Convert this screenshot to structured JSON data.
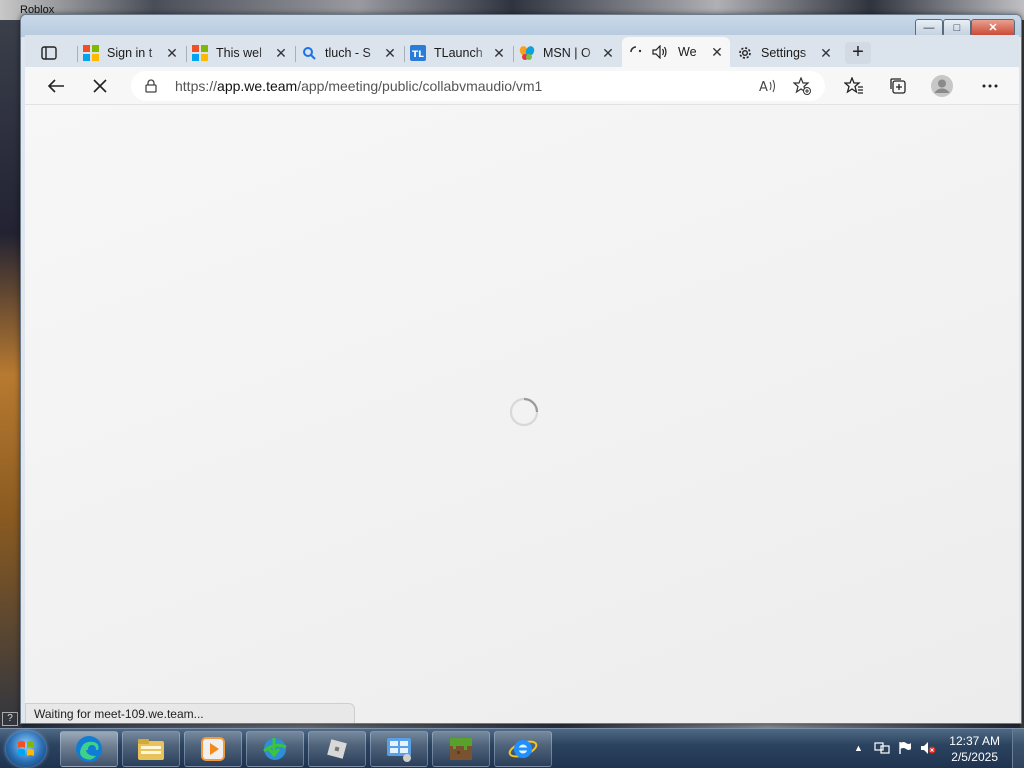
{
  "desktop": {
    "background_window_title": "Roblox"
  },
  "window": {
    "controls": {
      "minimize": "—",
      "maximize": "□",
      "close": "✕"
    }
  },
  "tabs": [
    {
      "label": "Sign in t",
      "icon": "microsoft-logo-icon",
      "active": false
    },
    {
      "label": "This wel",
      "icon": "microsoft-logo-icon",
      "active": false
    },
    {
      "label": "tluch - S",
      "icon": "search-icon",
      "active": false
    },
    {
      "label": "TLaunch",
      "icon": "tlauncher-icon",
      "active": false
    },
    {
      "label": "MSN | O",
      "icon": "msn-butterfly-icon",
      "active": false
    },
    {
      "label": "We",
      "icon": "loading-icon",
      "active": true
    },
    {
      "label": "Settings",
      "icon": "gear-icon",
      "active": false
    }
  ],
  "new_tab_label": "+",
  "address_bar": {
    "scheme": "https://",
    "host": "app.we.team",
    "path": "/app/meeting/public/collabvmaudio/vm1"
  },
  "status_bar": {
    "text": "Waiting for meet-109.we.team..."
  },
  "taskbar": {
    "items": [
      {
        "name": "edge-taskbar-icon"
      },
      {
        "name": "file-explorer-taskbar-icon"
      },
      {
        "name": "media-player-taskbar-icon"
      },
      {
        "name": "idm-taskbar-icon"
      },
      {
        "name": "roblox-taskbar-icon"
      },
      {
        "name": "control-panel-taskbar-icon"
      },
      {
        "name": "minecraft-taskbar-icon"
      },
      {
        "name": "internet-explorer-taskbar-icon"
      }
    ],
    "clock": {
      "time": "12:37 AM",
      "date": "2/5/2025"
    }
  },
  "colors": {
    "accent": "#0078d4",
    "window_frame": "#c9d9ea",
    "taskbar": "#2c4460"
  }
}
